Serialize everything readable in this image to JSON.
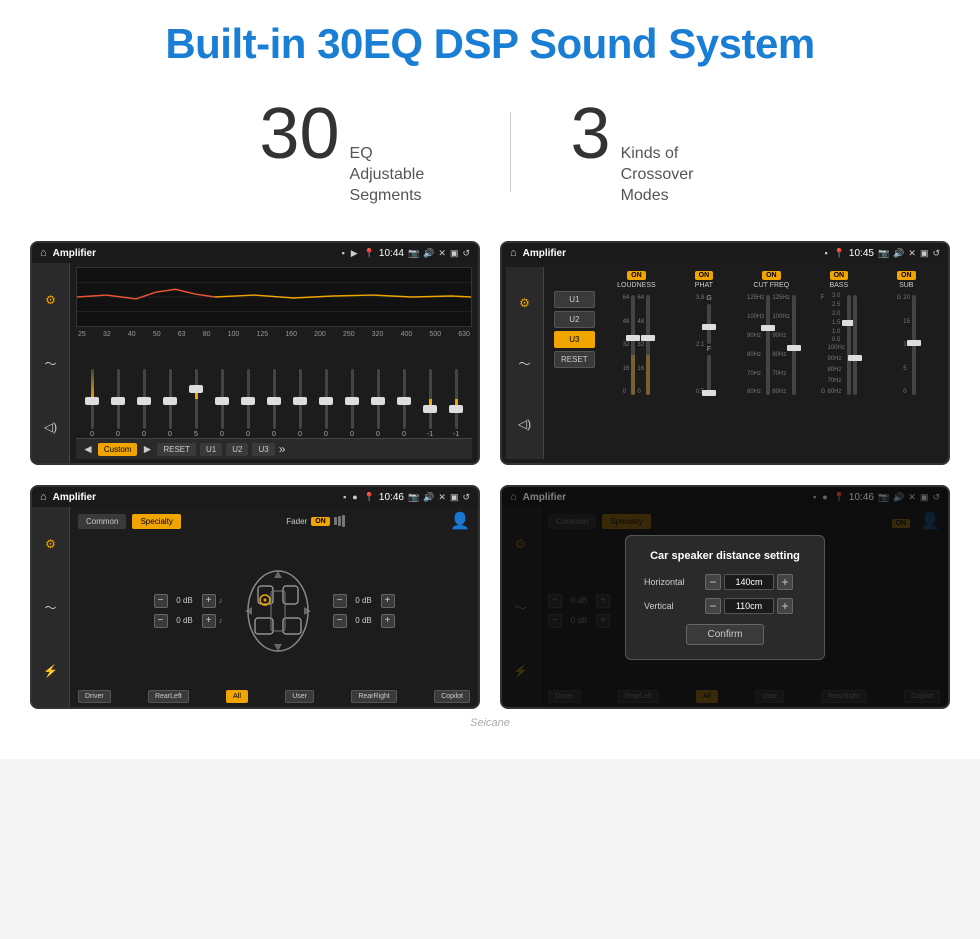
{
  "header": {
    "title": "Built-in 30EQ DSP Sound System"
  },
  "stats": [
    {
      "number": "30",
      "label": "EQ Adjustable\nSegments"
    },
    {
      "number": "3",
      "label": "Kinds of\nCrossover Modes"
    }
  ],
  "screen1": {
    "status": {
      "app": "Amplifier",
      "time": "10:44"
    },
    "freq_labels": [
      "25",
      "32",
      "40",
      "50",
      "63",
      "80",
      "100",
      "125",
      "160",
      "200",
      "250",
      "320",
      "400",
      "500",
      "630"
    ],
    "slider_values": [
      "0",
      "0",
      "0",
      "0",
      "5",
      "0",
      "0",
      "0",
      "0",
      "0",
      "0",
      "0",
      "0",
      "-1",
      "0",
      "-1"
    ],
    "bottom_btns": [
      "Custom",
      "RESET",
      "U1",
      "U2",
      "U3"
    ]
  },
  "screen2": {
    "status": {
      "app": "Amplifier",
      "time": "10:45"
    },
    "presets": [
      "U1",
      "U2",
      "U3"
    ],
    "active_preset": "U3",
    "channels": [
      {
        "name": "LOUDNESS",
        "on": true
      },
      {
        "name": "PHAT",
        "on": true
      },
      {
        "name": "CUT FREQ",
        "on": true
      },
      {
        "name": "BASS",
        "on": true
      },
      {
        "name": "SUB",
        "on": true
      }
    ],
    "reset_label": "RESET"
  },
  "screen3": {
    "status": {
      "app": "Amplifier",
      "time": "10:46"
    },
    "tabs": [
      "Common",
      "Specialty"
    ],
    "active_tab": "Specialty",
    "fader_label": "Fader",
    "fader_on": "ON",
    "db_values": [
      "0 dB",
      "0 dB",
      "0 dB",
      "0 dB"
    ],
    "bottom_btns": [
      "Driver",
      "RearLeft",
      "All",
      "User",
      "RearRight",
      "Copilot"
    ]
  },
  "screen4": {
    "status": {
      "app": "Amplifier",
      "time": "10:46"
    },
    "tabs": [
      "Common",
      "Specialty"
    ],
    "active_tab": "Specialty",
    "dialog": {
      "title": "Car speaker distance setting",
      "fields": [
        {
          "label": "Horizontal",
          "value": "140cm"
        },
        {
          "label": "Vertical",
          "value": "110cm"
        }
      ],
      "confirm_label": "Confirm",
      "db_values": [
        "0 dB",
        "0 dB"
      ]
    },
    "bottom_btns": [
      "Driver",
      "RearLeft",
      "All",
      "User",
      "RearRight",
      "Copilot"
    ]
  },
  "watermark": "Seicane"
}
